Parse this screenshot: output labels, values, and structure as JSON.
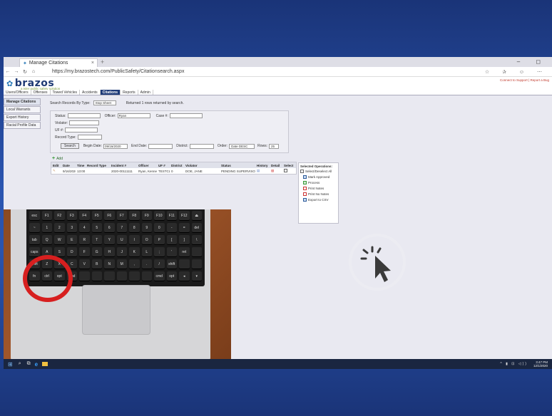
{
  "browser": {
    "tab_title": "Manage Citations",
    "tab_close": "×",
    "new_tab": "+",
    "window_controls": "–  ◻",
    "back": "←",
    "forward": "→",
    "refresh": "↻",
    "home": "⌂",
    "url": "https://my.brazostech.com/PublicSafety/Citationsearch.aspx",
    "addr_icons": "☆ ✰ ☺ ⋯"
  },
  "app": {
    "logo": "brazos",
    "tagline": "a tyler public safety solution",
    "support_link": "Connect to Support | Report a Bug"
  },
  "menu": [
    "Users/Officers",
    "Offenses",
    "Towed Vehicles",
    "Accidents",
    "Citations",
    "Reports",
    "Admin"
  ],
  "menu_active": "Citations",
  "sidebar": {
    "items": [
      "Manage Citations",
      "Local Warrants",
      "Export History",
      "Racial Profile Data"
    ]
  },
  "search": {
    "label": "Search Records By Type:",
    "type_value": "Stop Sheet",
    "result_text": "Returned 1 rows returned by search.",
    "status_label": "Status:",
    "officer_label": "Officer:",
    "officer_value": "Ryan",
    "case_label": "Case #:",
    "violator_label": "Violator:",
    "ufnum_label": "UF #:",
    "record_type_label": "Record Type:",
    "search_button": "Search",
    "begin_date_label": "Begin Date:",
    "begin_date_value": "09/16/2020",
    "end_date_label": "End Date:",
    "district_label": "District:",
    "order_label": "Order:",
    "order_value": "Date DESC",
    "rows_label": "Rows:",
    "rows_value": "25"
  },
  "add_label": "Add",
  "grid": {
    "headers": [
      "Edit",
      "Date",
      "Time",
      "Record Type",
      "Incident #",
      "Officer",
      "UF #",
      "District",
      "Violator",
      "Status",
      "History",
      "Detail",
      "Select"
    ],
    "rows": [
      [
        "✎",
        "9/16/2020",
        "13:00",
        "",
        "2020-00111111",
        "Ryan, Kenneth",
        "TESTCLEA",
        "0",
        "DOE, JANE",
        "PENDING SUPERVISOR APPROVAL-EW",
        "",
        "",
        ""
      ]
    ]
  },
  "selected_ops": {
    "title": "Selected Operations:",
    "select_all": "Select/Deselect All",
    "items": [
      "Mark Approved",
      "Process",
      "Print Notes",
      "Print No Notes",
      "Export to CSV"
    ]
  },
  "taskbar": {
    "time": "3:47 PM",
    "date": "12/1/2020",
    "search_icon": "⌕",
    "task_icon": "⧉",
    "tray": "^ ▮ ⊡ ◁))"
  },
  "keyboard_keys": [
    "esc",
    "F1",
    "F2",
    "F3",
    "F4",
    "F5",
    "F6",
    "F7",
    "F8",
    "F9",
    "F10",
    "F11",
    "F12",
    "⏏",
    "~",
    "1",
    "2",
    "3",
    "4",
    "5",
    "6",
    "7",
    "8",
    "9",
    "0",
    "-",
    "=",
    "del",
    "tab",
    "Q",
    "W",
    "E",
    "R",
    "T",
    "Y",
    "U",
    "I",
    "O",
    "P",
    "[",
    "]",
    "\\",
    "caps",
    "A",
    "S",
    "D",
    "F",
    "G",
    "H",
    "J",
    "K",
    "L",
    ";",
    "'",
    "ret",
    "",
    "shift",
    "Z",
    "X",
    "C",
    "V",
    "B",
    "N",
    "M",
    ",",
    ".",
    "/",
    "shift",
    "",
    ""
  ],
  "keyboard_bottom": [
    "fn",
    "ctrl",
    "opt",
    "cmd",
    "",
    "",
    "",
    "",
    "",
    "",
    "cmd",
    "opt",
    "◂",
    "▾"
  ],
  "colors": {
    "slide_blue": "#2b55b0",
    "menu_active": "#1d3a78",
    "red_circle": "#d71f1f",
    "taskbar": "#1a2640"
  }
}
